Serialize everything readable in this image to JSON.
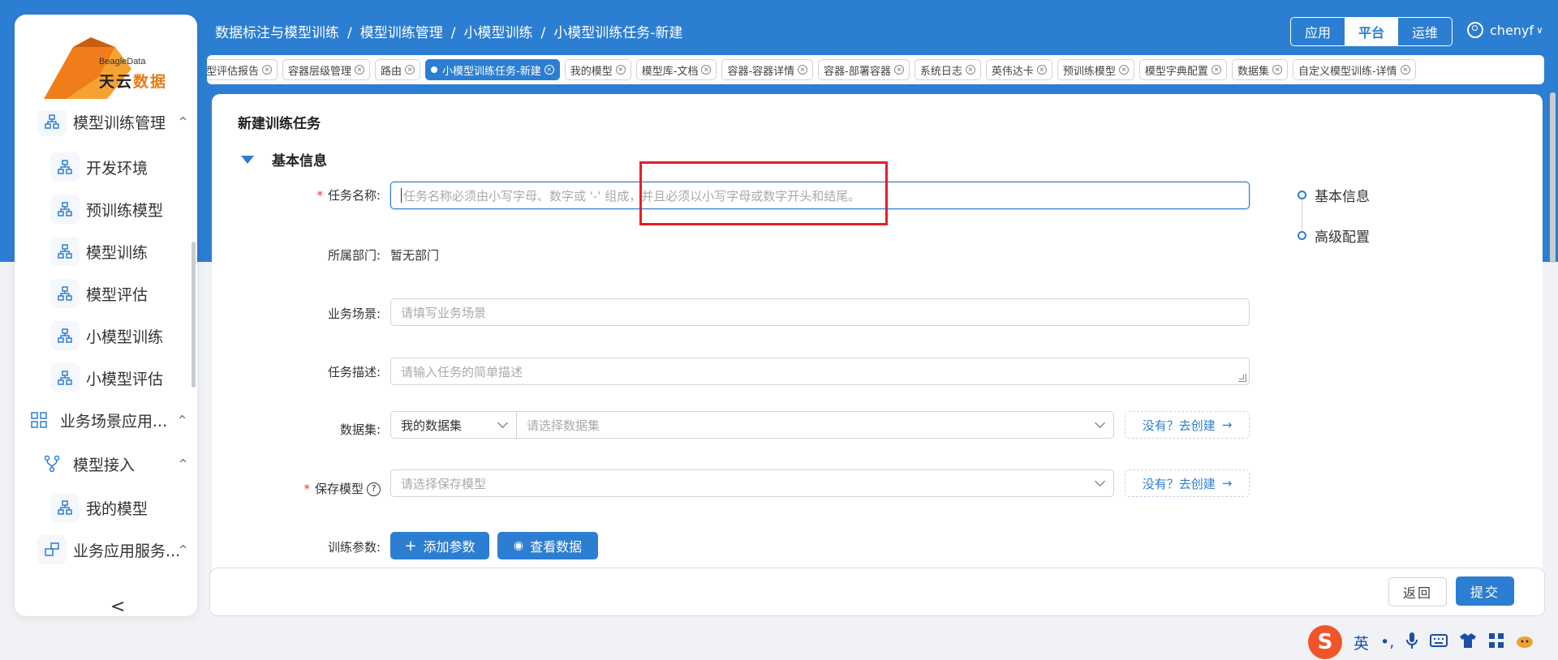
{
  "breadcrumb": [
    "数据标注与模型训练",
    "模型训练管理",
    "小模型训练",
    "小模型训练任务-新建"
  ],
  "breadcrumb_sep": "/",
  "mode_switch": [
    "应用",
    "平台",
    "运维"
  ],
  "mode_active": "平台",
  "user": {
    "name": "chenyf"
  },
  "logo": {
    "en": "BeagleData",
    "cn_a": "天云",
    "cn_b": "数据"
  },
  "sidebar": {
    "items": [
      {
        "label": "模型训练管理",
        "arrow": "^"
      },
      {
        "label": "开发环境"
      },
      {
        "label": "预训练模型"
      },
      {
        "label": "模型训练"
      },
      {
        "label": "模型评估"
      },
      {
        "label": "小模型训练"
      },
      {
        "label": "小模型评估"
      },
      {
        "label": "业务场景应用...",
        "arrow": "^"
      },
      {
        "label": "模型接入",
        "arrow": "^"
      },
      {
        "label": "我的模型"
      },
      {
        "label": "业务应用服务...",
        "arrow": "^"
      }
    ],
    "collapse": "<"
  },
  "tabs": [
    {
      "label": "型评估报告"
    },
    {
      "label": "容器层级管理"
    },
    {
      "label": "路由"
    },
    {
      "label": "小模型训练任务-新建",
      "active": true
    },
    {
      "label": "我的模型"
    },
    {
      "label": "模型库-文档"
    },
    {
      "label": "容器-容器详情"
    },
    {
      "label": "容器-部署容器"
    },
    {
      "label": "系统日志"
    },
    {
      "label": "英伟达卡"
    },
    {
      "label": "预训练模型"
    },
    {
      "label": "模型字典配置"
    },
    {
      "label": "数据集"
    },
    {
      "label": "自定义模型训练-详情"
    }
  ],
  "page": {
    "title": "新建训练任务",
    "section": "基本信息"
  },
  "form": {
    "task_name": {
      "label": "任务名称:",
      "required": "*",
      "placeholder": "任务名称必须由小写字母、数字或 '-' 组成，并且必须以小写字母或数字开头和结尾。"
    },
    "department": {
      "label": "所属部门:",
      "value": "暂无部门"
    },
    "scene": {
      "label": "业务场景:",
      "placeholder": "请填写业务场景"
    },
    "desc": {
      "label": "任务描述:",
      "placeholder": "请输入任务的简单描述"
    },
    "dataset": {
      "label": "数据集:",
      "type_value": "我的数据集",
      "placeholder": "请选择数据集",
      "create": "没有？去创建"
    },
    "save_model": {
      "label": "保存模型",
      "required": "*",
      "help": "?",
      "placeholder": "请选择保存模型",
      "create": "没有？去创建"
    },
    "params": {
      "label": "训练参数:",
      "add": "添加参数",
      "view": "查看数据"
    }
  },
  "anchor_nav": [
    "基本信息",
    "高级配置"
  ],
  "footer": {
    "back": "返回",
    "submit": "提交"
  },
  "ime": {
    "mode": "英",
    "punct": "•,"
  },
  "colors": {
    "primary": "#2c7ed2",
    "header_bg": "#2c7ed2",
    "required": "#e33333",
    "highlight_box": "#e0202a"
  }
}
